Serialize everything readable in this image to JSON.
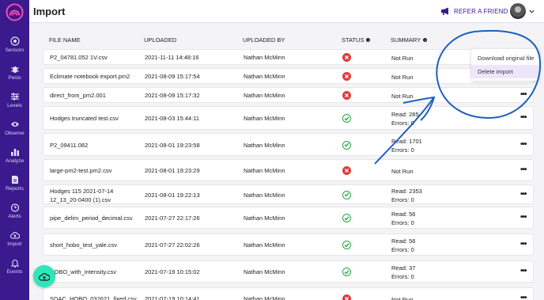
{
  "app": {
    "title": "Import"
  },
  "header": {
    "refer_label": "REFER A FRIEND"
  },
  "sidebar": {
    "items": [
      {
        "label": "Sensors",
        "icon": "sensors-icon"
      },
      {
        "label": "Pests",
        "icon": "bug-icon"
      },
      {
        "label": "Levels",
        "icon": "sliders-icon"
      },
      {
        "label": "Observe",
        "icon": "eye-icon"
      },
      {
        "label": "Analyze",
        "icon": "bar-chart-icon"
      },
      {
        "label": "Reports",
        "icon": "document-icon"
      },
      {
        "label": "Alerts",
        "icon": "clock-icon"
      },
      {
        "label": "Import",
        "icon": "cloud-upload-icon"
      },
      {
        "label": "Events",
        "icon": "bell-icon"
      }
    ]
  },
  "table": {
    "headers": {
      "file_name": "FILE NAME",
      "uploaded": "UPLOADED",
      "uploaded_by": "UPLOADED BY",
      "status": "STATUS",
      "summary": "SUMMARY"
    },
    "rows": [
      {
        "file": "P2_04781.052 1V.csv",
        "uploaded": "2021-11-11 14:48:16",
        "by": "Nathan McMinn",
        "status": "error",
        "summary1": "Not Run",
        "summary2": ""
      },
      {
        "file": "Eclimate notebook export.pm2",
        "uploaded": "2021-08-09 15:17:54",
        "by": "Nathan McMinn",
        "status": "error",
        "summary1": "Not Run",
        "summary2": ""
      },
      {
        "file": "direct_from_pm2.001",
        "uploaded": "2021-08-09 15:17:32",
        "by": "Nathan McMinn",
        "status": "error",
        "summary1": "Not Run",
        "summary2": ""
      },
      {
        "file": "Hodges truncated test.csv",
        "uploaded": "2021-08-03 15:44:11",
        "by": "Nathan McMinn",
        "status": "ok",
        "summary1": "Read: 285",
        "summary2": "Errors: 0"
      },
      {
        "file": "P2_09411.082",
        "uploaded": "2021-08-01 19:23:58",
        "by": "Nathan McMinn",
        "status": "ok",
        "summary1": "Read: 1701",
        "summary2": "Errors: 0"
      },
      {
        "file": "large-pm2-test.pm2.csv",
        "uploaded": "2021-08-01 19:23:29",
        "by": "Nathan McMinn",
        "status": "error",
        "summary1": "Not Run",
        "summary2": ""
      },
      {
        "file": "Hodges 115 2021-07-14 12_13_20-0400 (1).csv",
        "uploaded": "2021-08-01 19:22:13",
        "by": "Nathan McMinn",
        "status": "ok",
        "summary1": "Read: 2353",
        "summary2": "Errors: 0"
      },
      {
        "file": "pipe_delim_period_decimal.csv",
        "uploaded": "2021-07-27 22:17:26",
        "by": "Nathan McMinn",
        "status": "ok",
        "summary1": "Read: 56",
        "summary2": "Errors: 0"
      },
      {
        "file": "short_hobo_test_yale.csv",
        "uploaded": "2021-07-27 22:02:26",
        "by": "Nathan McMinn",
        "status": "ok",
        "summary1": "Read: 56",
        "summary2": "Errors: 0"
      },
      {
        "file": "HOBO_with_intensity.csv",
        "uploaded": "2021-07-19 10:15:02",
        "by": "Nathan McMinn",
        "status": "ok",
        "summary1": "Read: 37",
        "summary2": "Errors: 0"
      },
      {
        "file": "SDAC_HOBO_032621_fixed.csv",
        "uploaded": "2021-07-19 10:14:41",
        "by": "Nathan McMinn",
        "status": "error",
        "summary1": "Not Run",
        "summary2": ""
      }
    ]
  },
  "menu": {
    "items": [
      {
        "label": "Download original file"
      },
      {
        "label": "Delete import"
      }
    ]
  },
  "colors": {
    "sidebar": "#3a1a8c",
    "accent": "#2ee6b8",
    "error": "#e23b3b",
    "ok": "#29a745",
    "annotation": "#1f5fbf"
  }
}
